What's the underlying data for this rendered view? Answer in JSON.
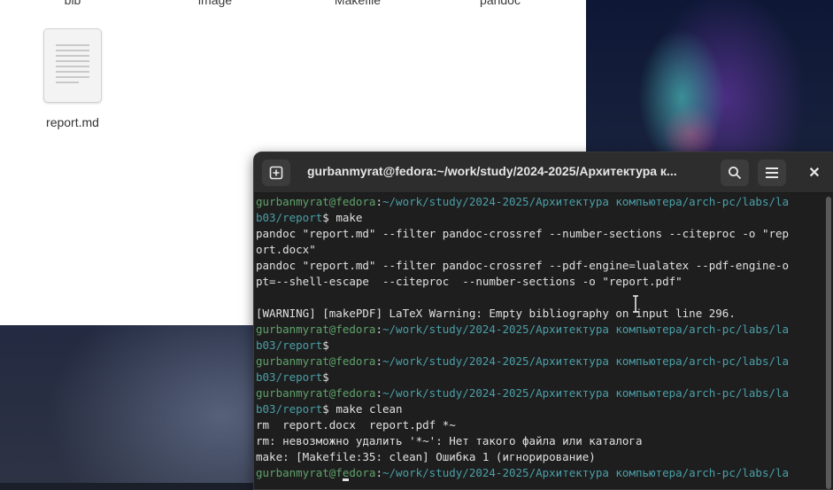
{
  "files": {
    "top_row": [
      "bib",
      "image",
      "Makefile",
      "pandoc"
    ],
    "items": [
      {
        "name": "report.md",
        "icon": "text-document-icon"
      }
    ]
  },
  "terminal": {
    "title": "gurbanmyrat@fedora:~/work/study/2024-2025/Архитектура к...",
    "prompt_user": "gurbanmyrat@fedora",
    "prompt_path_1": "~/work/study/2024-2025/Архитектура компьютера/arch-pc/labs/la",
    "prompt_path_2": "b03/report",
    "lines": {
      "cmd_make": "make",
      "out_1": "pandoc \"report.md\" --filter pandoc-crossref --number-sections --citeproc -o \"rep",
      "out_2": "ort.docx\"",
      "out_3": "pandoc \"report.md\" --filter pandoc-crossref --pdf-engine=lualatex --pdf-engine-o",
      "out_4": "pt=--shell-escape  --citeproc  --number-sections -o \"report.pdf\"",
      "out_5": "",
      "out_6": "[WARNING] [makePDF] LaTeX Warning: Empty bibliography on input line 296.",
      "cmd_clean": "make clean",
      "out_7": "rm  report.docx  report.pdf *~",
      "out_8": "rm: невозможно удалить '*~': Нет такого файла или каталога",
      "out_9": "make: [Makefile:35: clean] Ошибка 1 (игнорирование)"
    }
  },
  "colors": {
    "prompt_user": "#5ea36b",
    "prompt_path": "#4a9fa8",
    "terminal_bg": "#1e1e1e",
    "header_bg": "#2d2d2d"
  }
}
